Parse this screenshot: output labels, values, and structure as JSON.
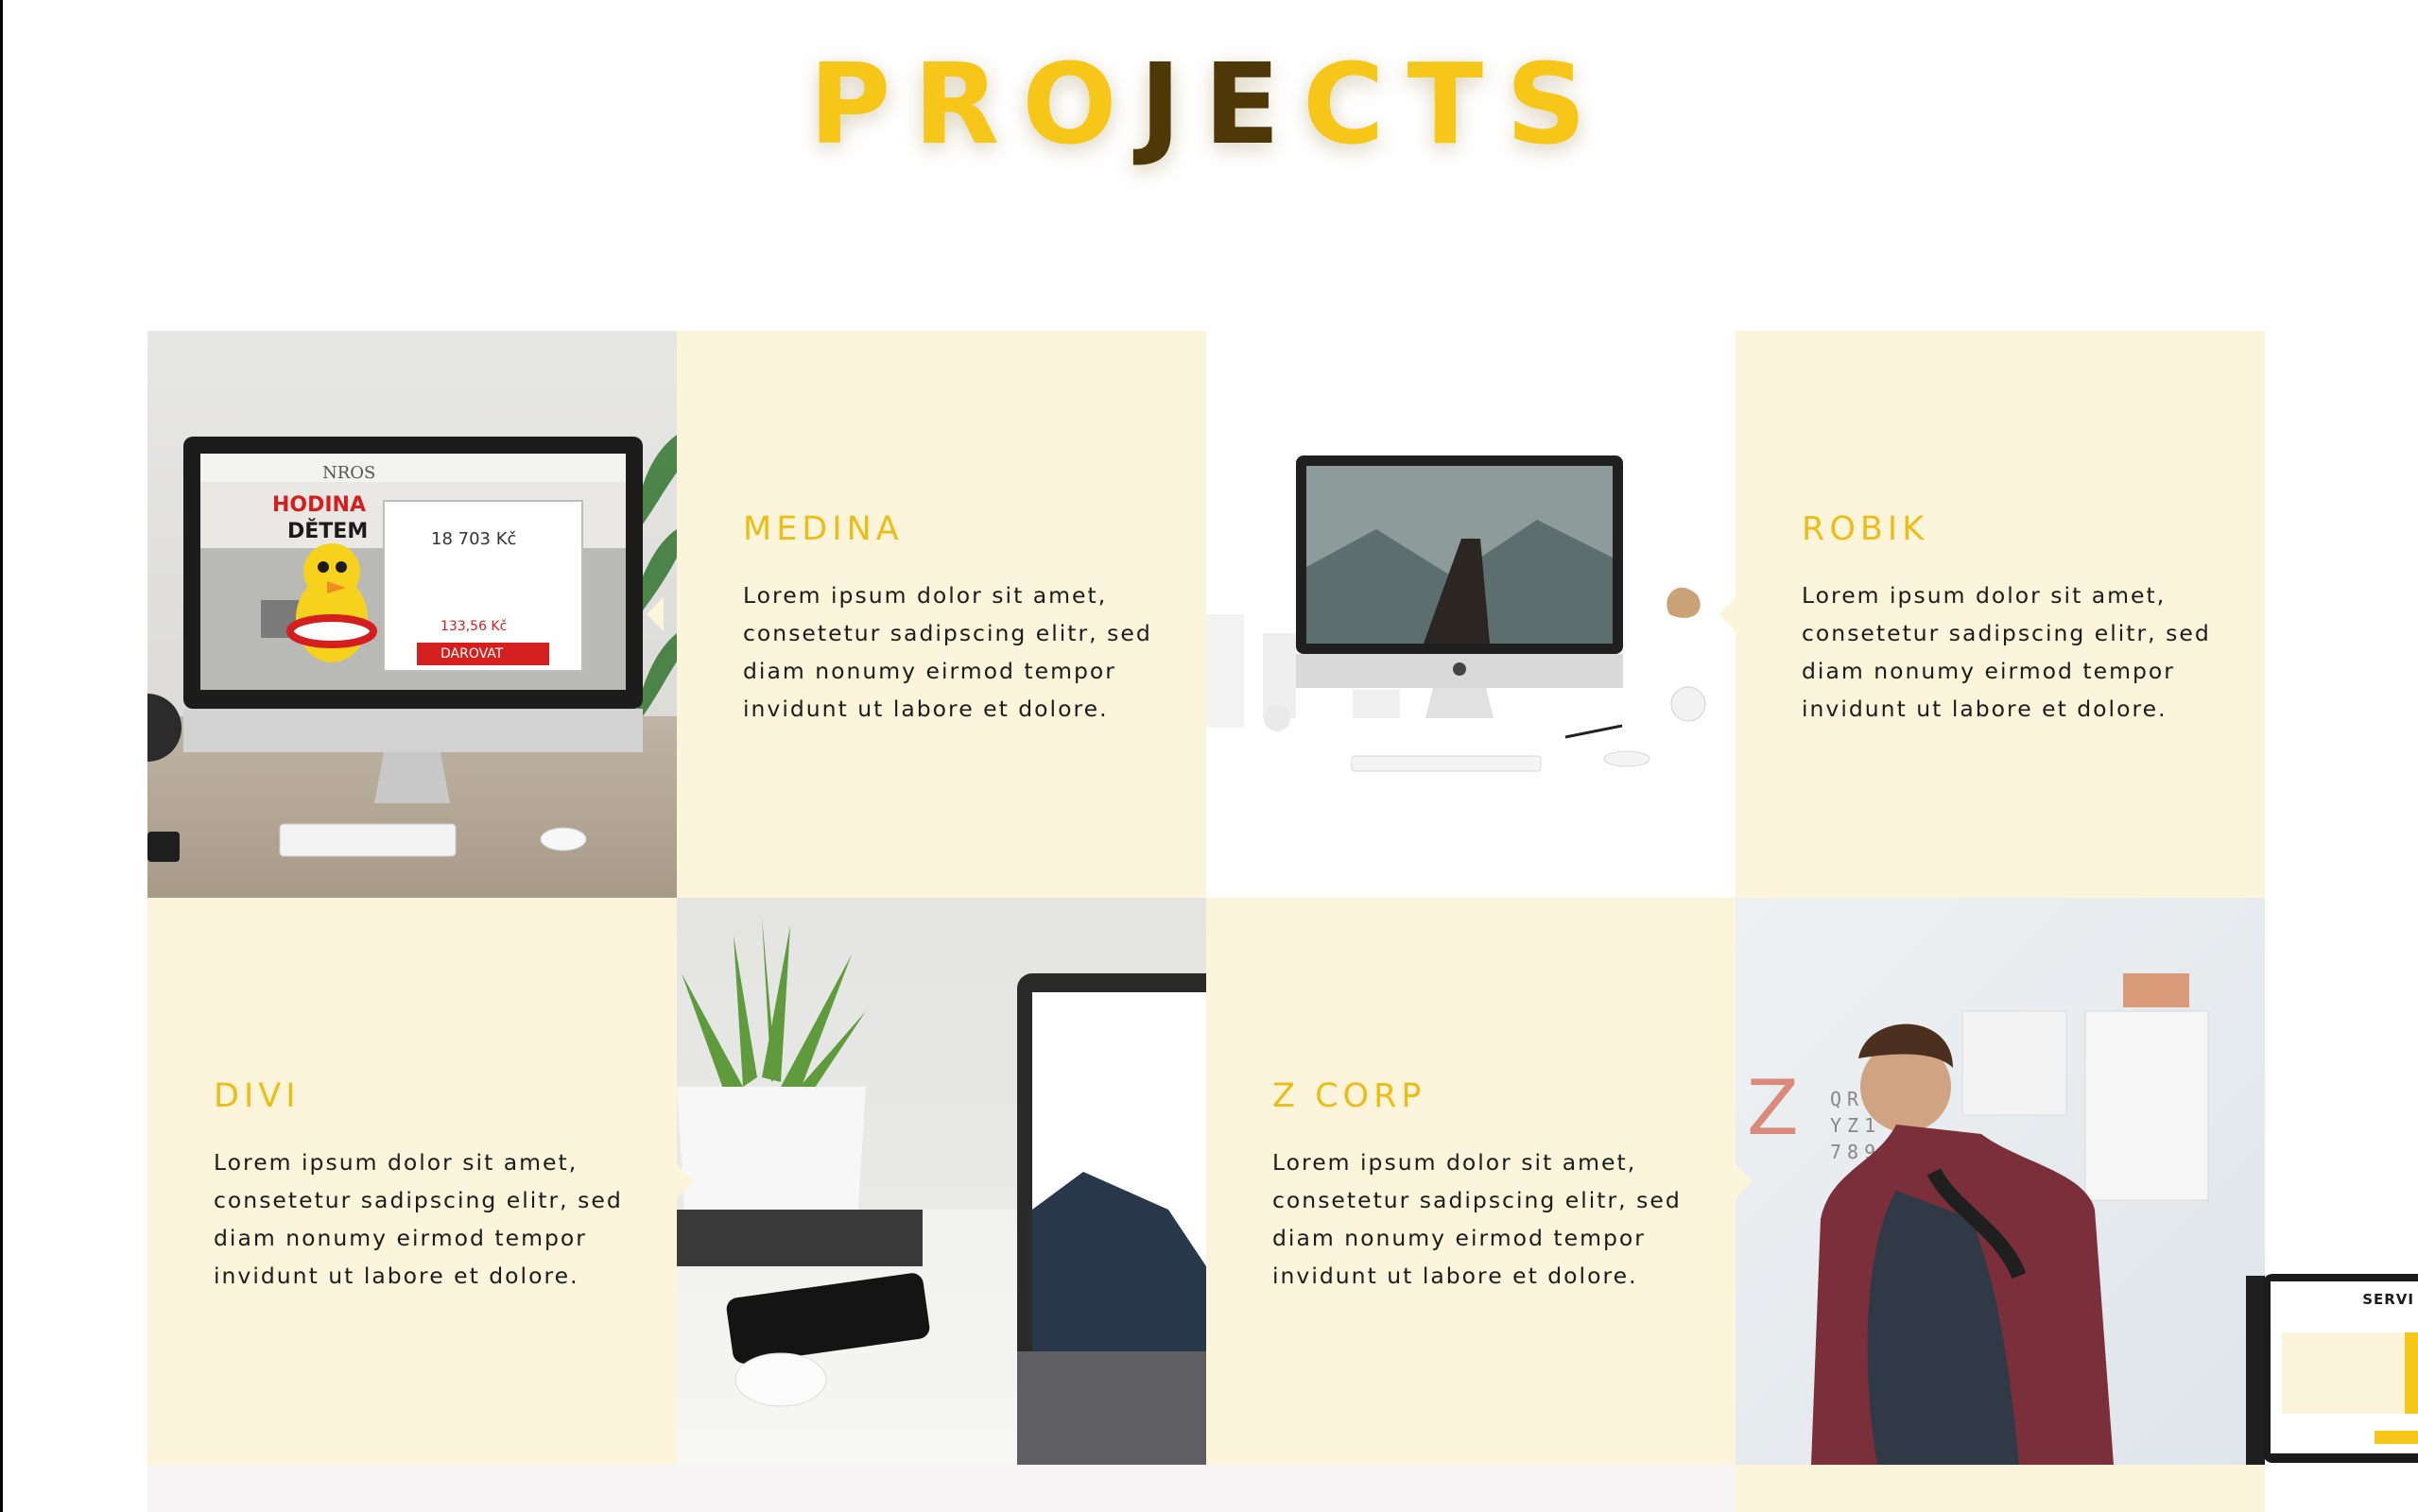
{
  "section": {
    "title_parts": [
      "PRO",
      "J",
      "E",
      "CTS"
    ]
  },
  "projects": [
    {
      "title": "MEDINA",
      "description": "Lorem ipsum dolor sit amet, consetetur sadipscing elitr, sed diam nonumy eirmod tempor invidunt ut labore et dolore.",
      "screen_text": {
        "headline_1": "HODINA",
        "headline_2": "DĚTEM",
        "brand": "NROS",
        "amount": "18 703 Kč",
        "amount_2": "133,56 Kč",
        "cta": "DAROVAT"
      }
    },
    {
      "title": "ROBIK",
      "description": "Lorem ipsum dolor sit amet, consetetur sadipscing elitr, sed diam nonumy eirmod tempor invidunt ut labore et dolore."
    },
    {
      "title": "DIVI",
      "description": "Lorem ipsum dolor sit amet, consetetur sadipscing elitr, sed diam nonumy eirmod tempor invidunt ut labore et dolore."
    },
    {
      "title": "Z CORP",
      "description": "Lorem ipsum dolor sit amet, consetetur sadipscing elitr, sed diam nonumy eirmod tempor invidunt ut labore et dolore."
    }
  ],
  "peek_laptop": {
    "label": "SERVI"
  },
  "colors": {
    "accent": "#ebbd17",
    "title_yellow": "#f6c719",
    "card_bg": "#fcf5db",
    "text": "#1b1b1b"
  }
}
